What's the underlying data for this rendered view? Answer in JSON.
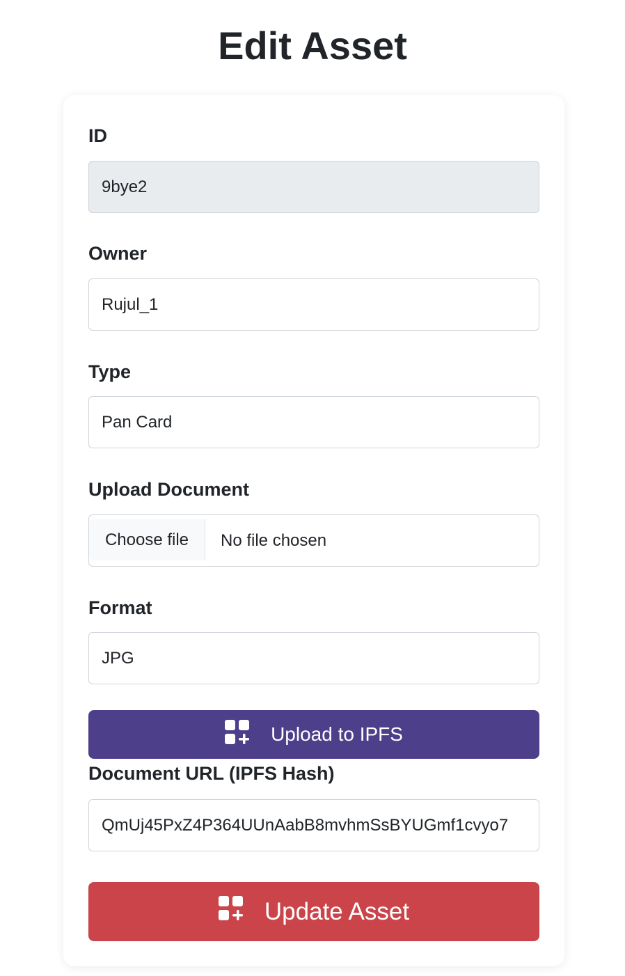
{
  "page": {
    "title": "Edit Asset"
  },
  "form": {
    "id": {
      "label": "ID",
      "value": "9bye2"
    },
    "owner": {
      "label": "Owner",
      "value": "Rujul_1"
    },
    "type": {
      "label": "Type",
      "value": "Pan Card"
    },
    "upload": {
      "label": "Upload Document",
      "button_label": "Choose file",
      "status": "No file chosen"
    },
    "format": {
      "label": "Format",
      "value": "JPG"
    },
    "upload_ipfs": {
      "label": "Upload to IPFS",
      "icon": "grid-plus-icon"
    },
    "document_url": {
      "label": "Document URL (IPFS Hash)",
      "value": "QmUj45PxZ4P364UUnAabB8mvhmSsBYUGmf1cvyo7"
    },
    "update": {
      "label": "Update Asset",
      "icon": "grid-plus-icon"
    }
  },
  "colors": {
    "upload_button": "#4d3f89",
    "update_button": "#cb444a",
    "readonly_field": "#e9ecef",
    "border": "#ced4da"
  }
}
